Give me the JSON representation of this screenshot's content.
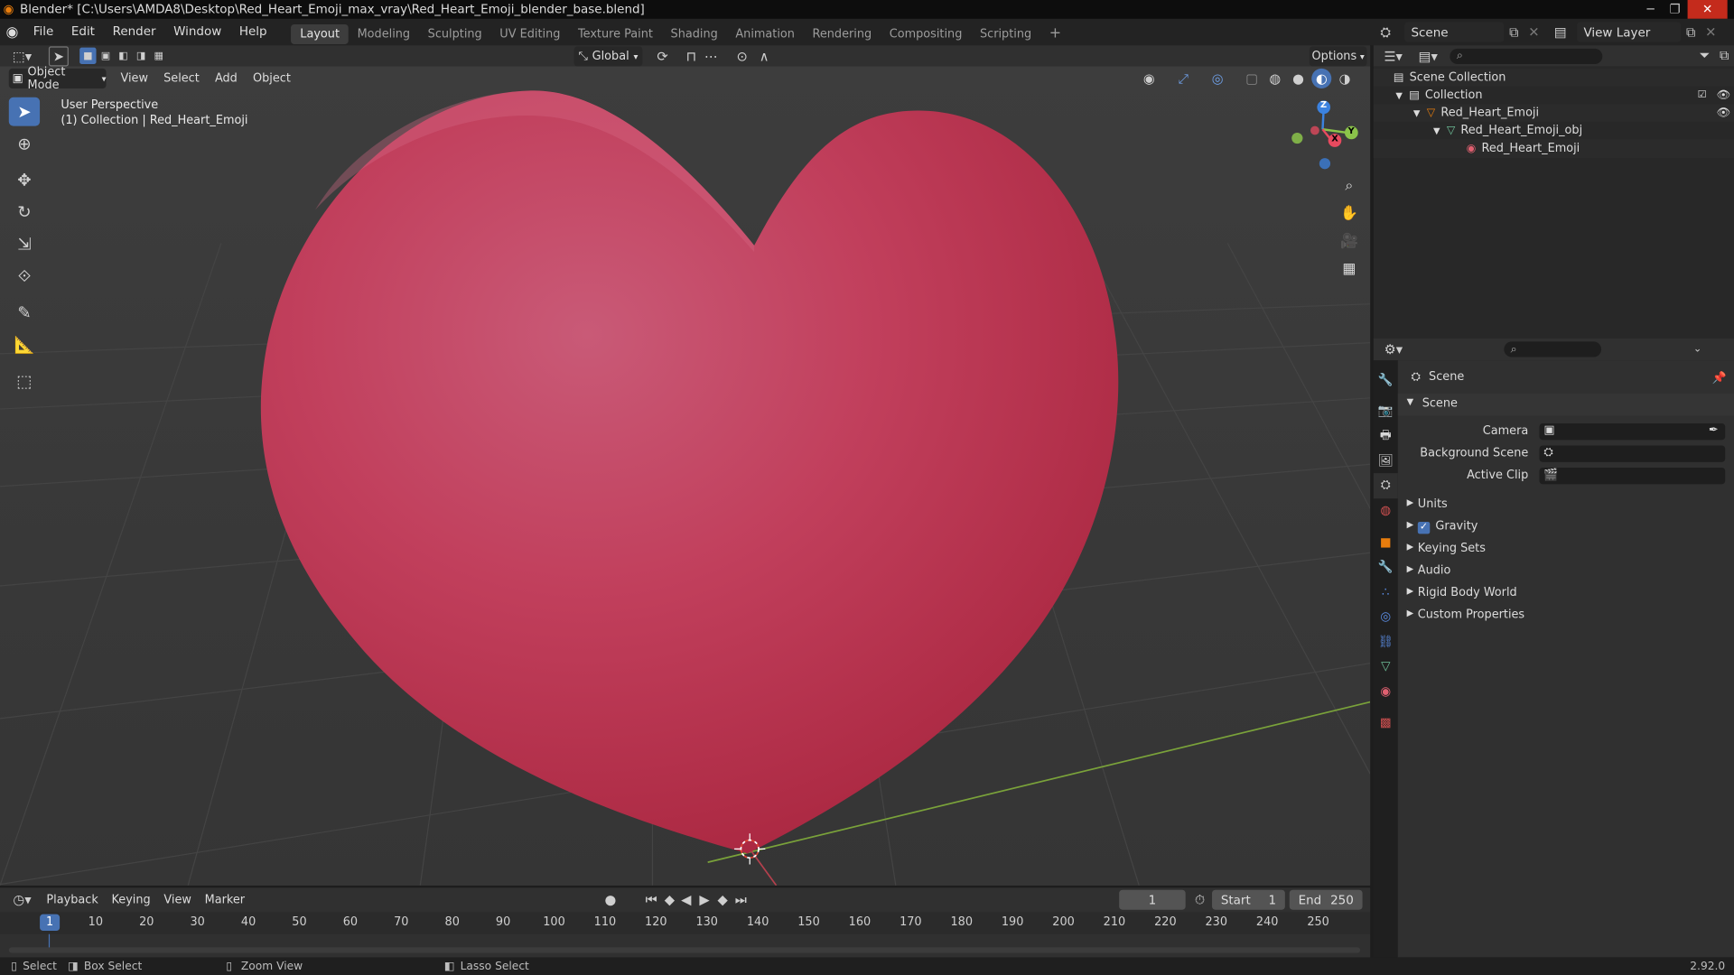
{
  "window": {
    "title": "Blender* [C:\\Users\\AMDA8\\Desktop\\Red_Heart_Emoji_max_vray\\Red_Heart_Emoji_blender_base.blend]",
    "min": "─",
    "max": "❐",
    "close": "✕"
  },
  "menu": [
    "File",
    "Edit",
    "Render",
    "Window",
    "Help"
  ],
  "workspaces": [
    "Layout",
    "Modeling",
    "Sculpting",
    "UV Editing",
    "Texture Paint",
    "Shading",
    "Animation",
    "Rendering",
    "Compositing",
    "Scripting"
  ],
  "top_right": {
    "scene_label": "Scene",
    "viewlayer_label": "View Layer"
  },
  "tool_header": {
    "orientation": "Global",
    "options": "Options"
  },
  "viewport_header": {
    "mode": "Object Mode",
    "menus": [
      "View",
      "Select",
      "Add",
      "Object"
    ]
  },
  "viewport": {
    "perspective": "User Perspective",
    "collection": "(1) Collection | Red_Heart_Emoji",
    "gizmo": {
      "z": "Z",
      "y": "Y",
      "x": "X"
    }
  },
  "outliner": {
    "items": [
      {
        "label": "Scene Collection"
      },
      {
        "label": "Collection"
      },
      {
        "label": "Red_Heart_Emoji"
      },
      {
        "label": "Red_Heart_Emoji_obj"
      },
      {
        "label": "Red_Heart_Emoji"
      }
    ]
  },
  "properties": {
    "context": "Scene",
    "panel": "Scene",
    "fields": {
      "camera": "Camera",
      "background_scene": "Background Scene",
      "active_clip": "Active Clip"
    },
    "subpanels": [
      "Units",
      "Gravity",
      "Keying Sets",
      "Audio",
      "Rigid Body World",
      "Custom Properties"
    ],
    "gravity_checked": true
  },
  "timeline": {
    "menus": [
      "Playback",
      "Keying",
      "View",
      "Marker"
    ],
    "current_frame": "1",
    "start_label": "Start",
    "start": "1",
    "end_label": "End",
    "end": "250",
    "ticks": [
      "1",
      "10",
      "20",
      "30",
      "40",
      "50",
      "60",
      "70",
      "80",
      "90",
      "100",
      "110",
      "120",
      "130",
      "140",
      "150",
      "160",
      "170",
      "180",
      "190",
      "200",
      "210",
      "220",
      "230",
      "240",
      "250"
    ]
  },
  "statusbar": {
    "select": "Select",
    "box_select": "Box Select",
    "zoom_view": "Zoom View",
    "lasso_select": "Lasso Select",
    "version": "2.92.0"
  },
  "colors": {
    "accent": "#4772b3",
    "heart": "#c33a55",
    "x_axis": "#e84a5f",
    "y_axis": "#8bc34a",
    "z_axis": "#3b82e0"
  }
}
